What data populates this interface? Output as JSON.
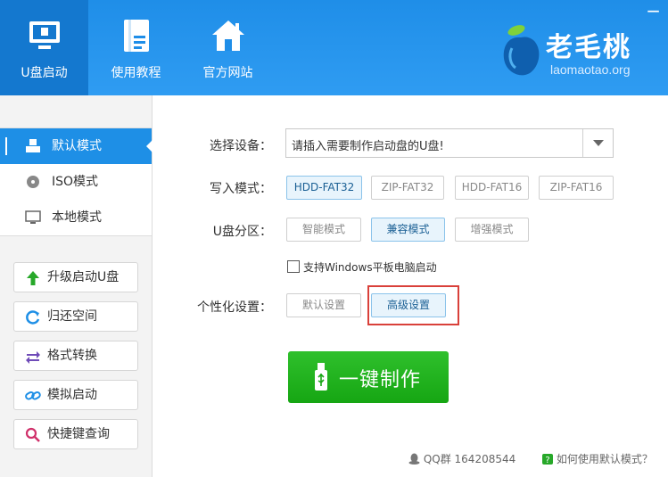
{
  "header": {
    "nav": [
      {
        "label": "U盘启动",
        "icon": "usb-monitor-icon",
        "active": true
      },
      {
        "label": "使用教程",
        "icon": "tutorial-book-icon"
      },
      {
        "label": "官方网站",
        "icon": "home-icon"
      }
    ],
    "brand": {
      "name": "老毛桃",
      "url": "laomaotao.org",
      "icon": "peach-logo-icon"
    },
    "close_label": "−"
  },
  "sidebar": {
    "modes": [
      {
        "label": "默认模式",
        "icon": "usb-drive-icon",
        "active": true
      },
      {
        "label": "ISO模式",
        "icon": "disc-icon"
      },
      {
        "label": "本地模式",
        "icon": "monitor-icon"
      }
    ],
    "tools": [
      {
        "label": "升级启动U盘",
        "icon": "arrow-up-icon"
      },
      {
        "label": "归还空间",
        "icon": "refresh-icon"
      },
      {
        "label": "格式转换",
        "icon": "swap-icon"
      },
      {
        "label": "模拟启动",
        "icon": "link-icon"
      },
      {
        "label": "快捷键查询",
        "icon": "search-icon"
      }
    ]
  },
  "main": {
    "device": {
      "label": "选择设备：",
      "value": "请插入需要制作启动盘的U盘!"
    },
    "write_mode": {
      "label": "写入模式：",
      "options": [
        "HDD-FAT32",
        "ZIP-FAT32",
        "HDD-FAT16",
        "ZIP-FAT16"
      ],
      "selected": "HDD-FAT32"
    },
    "partition": {
      "label": "U盘分区：",
      "options": [
        "智能模式",
        "兼容模式",
        "增强模式"
      ],
      "selected": "兼容模式"
    },
    "tablet_support": {
      "label": "支持Windows平板电脑启动",
      "checked": false
    },
    "personalize": {
      "label": "个性化设置：",
      "options": [
        "默认设置",
        "高级设置"
      ],
      "selected": "高级设置"
    },
    "make_button": "一键制作"
  },
  "footer": {
    "qq": "QQ群 164208544",
    "help": "如何使用默认模式？"
  },
  "colors": {
    "accent": "#1e8fe6",
    "make": "#1fb01c",
    "highlight": "#d9403a"
  }
}
